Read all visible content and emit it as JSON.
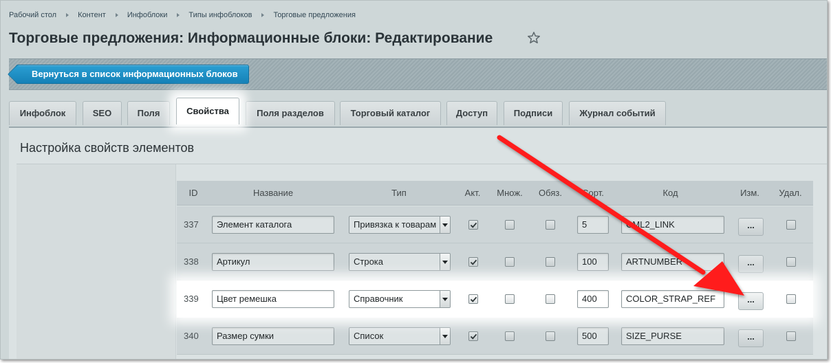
{
  "breadcrumb": [
    "Рабочий стол",
    "Контент",
    "Инфоблоки",
    "Типы инфоблоков",
    "Торговые предложения"
  ],
  "page_title": "Торговые предложения: Информационные блоки: Редактирование",
  "toolbar": {
    "back_label": "Вернуться в список информационных блоков"
  },
  "tabs": [
    "Инфоблок",
    "SEO",
    "Поля",
    "Свойства",
    "Поля разделов",
    "Торговый каталог",
    "Доступ",
    "Подписи",
    "Журнал событий"
  ],
  "active_tab": "Свойства",
  "section_title": "Настройка свойств элементов",
  "table": {
    "headers": {
      "id": "ID",
      "name": "Название",
      "type": "Тип",
      "active": "Акт.",
      "multiple": "Множ.",
      "required": "Обяз.",
      "sort": "Сорт.",
      "code": "Код",
      "edit": "Изм.",
      "delete": "Удал."
    },
    "edit_label": "...",
    "rows": [
      {
        "id": "337",
        "name": "Элемент каталога",
        "type": "Привязка к товарам",
        "active": true,
        "multiple": false,
        "required": false,
        "sort": "5",
        "code": "CML2_LINK",
        "delete": false
      },
      {
        "id": "338",
        "name": "Артикул",
        "type": "Строка",
        "active": true,
        "multiple": false,
        "required": false,
        "sort": "100",
        "code": "ARTNUMBER",
        "delete": false
      },
      {
        "id": "339",
        "name": "Цвет ремешка",
        "type": "Справочник",
        "active": true,
        "multiple": false,
        "required": false,
        "sort": "400",
        "code": "COLOR_STRAP_REF",
        "delete": false
      },
      {
        "id": "340",
        "name": "Размер сумки",
        "type": "Список",
        "active": true,
        "multiple": false,
        "required": false,
        "sort": "500",
        "code": "SIZE_PURSE",
        "delete": false
      }
    ]
  },
  "colors": {
    "accent_button": "#1a8ec6",
    "annotation_arrow": "#ff1a1a",
    "frame_background": "#ced7d8"
  },
  "icons": {
    "favorite": "star-icon",
    "checked": "check-mark-icon"
  }
}
